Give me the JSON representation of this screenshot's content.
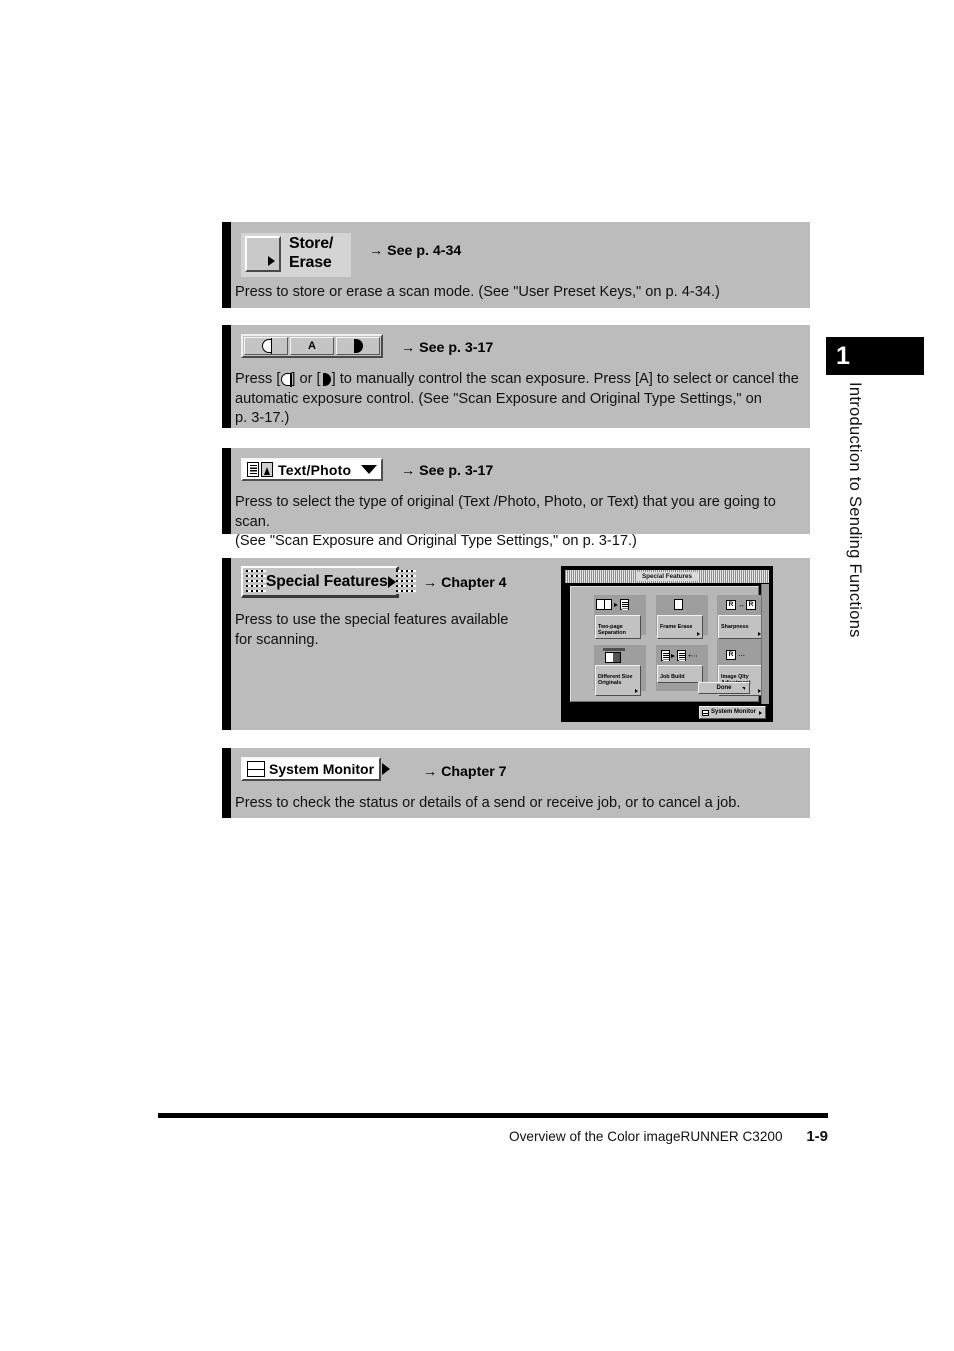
{
  "page": {
    "chapter_number": "1",
    "chapter_vertical_title": "Introduction to Sending Functions",
    "footer_title": "Overview of the Color imageRUNNER C3200",
    "footer_page": "1-9"
  },
  "sections": [
    {
      "key_label": "Store/\nErase",
      "key_icon": "square-arrow-key-icon",
      "reference": "→ See p. 4-34",
      "description": "Press to store or erase a scan mode. (See \"User Preset Keys,\" on p. 4-34.)"
    },
    {
      "key_buttons": [
        "exposure-light-icon",
        "A",
        "exposure-dark-icon"
      ],
      "reference": "→ See p. 3-17",
      "description": "Press [ ] or [ ] to manually control the scan exposure. Press [A] to select or cancel the automatic exposure control. (See \"Scan Exposure and Original Type Settings,\" on p. 3-17.)",
      "description_parts": {
        "line1_a": "Press [",
        "line1_b": "] or [",
        "line1_c": "] to manually control the scan exposure. Press [A] to select or cancel the",
        "line2": "automatic exposure control. (See \"Scan Exposure and Original Type Settings,\" on",
        "line3": "p. 3-17.)"
      }
    },
    {
      "key_label": "Text/Photo",
      "key_icons": [
        "text-lines-icon",
        "photo-icon",
        "chevron-down-icon"
      ],
      "reference": "→ See p. 3-17",
      "description": "Press to select the type of original (Text /Photo, Photo, or Text) that you are going to scan.\n(See \"Scan Exposure and Original Type Settings,\" on p. 3-17.)"
    },
    {
      "key_label": "Special Features",
      "key_icons": [
        "dot-grid-icon",
        "triangle-right-icon"
      ],
      "reference": "→ Chapter 4",
      "description": "Press to use the special features available\nfor scanning."
    },
    {
      "key_label": "System Monitor",
      "key_icons": [
        "stack-bars-icon",
        "triangle-right-icon"
      ],
      "reference": "→ Chapter 7",
      "description": "Press to check the status or details of a send or receive job, or to cancel a job."
    }
  ],
  "panel": {
    "title": "Special Features",
    "buttons": [
      {
        "label": "Two-page\nSeparation",
        "glyph": "two-page-separation-icon"
      },
      {
        "label": "Frame Erase",
        "glyph": "frame-erase-icon"
      },
      {
        "label": "Sharpness",
        "glyph": "sharpness-icon"
      },
      {
        "label": "Different Size\nOriginals",
        "glyph": "different-size-originals-icon"
      },
      {
        "label": "Job Build",
        "glyph": "job-build-icon"
      },
      {
        "label": "Image Qlty\nAdjustment",
        "glyph": "image-quality-adjustment-icon"
      }
    ],
    "done_label": "Done",
    "system_monitor_label": "System Monitor"
  },
  "colors": {
    "section_background": "#bcbcbc",
    "left_bar": "#000000",
    "key_face": "#c4c4c4",
    "panel_frame": "#000000",
    "panel_body": "#b7b7b7"
  }
}
